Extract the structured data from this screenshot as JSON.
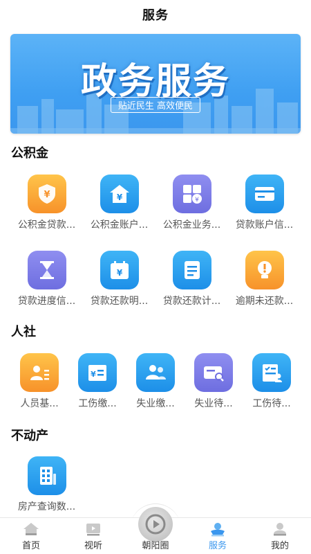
{
  "header": {
    "title": "服务"
  },
  "banner": {
    "title": "政务服务",
    "slogan": "贴近民生 高效便民"
  },
  "sections": [
    {
      "title": "公积金",
      "items": [
        {
          "label": "公积金贷款...",
          "icon": "shield-yuan-icon",
          "color": "orange"
        },
        {
          "label": "公积金账户...",
          "icon": "house-yuan-icon",
          "color": "blue"
        },
        {
          "label": "公积金业务...",
          "icon": "grid-yuan-icon",
          "color": "purple"
        },
        {
          "label": "贷款账户信...",
          "icon": "card-icon",
          "color": "blue"
        },
        {
          "label": "贷款进度信...",
          "icon": "hourglass-icon",
          "color": "purple"
        },
        {
          "label": "贷款还款明...",
          "icon": "calendar-yuan-icon",
          "color": "blue"
        },
        {
          "label": "贷款还款计...",
          "icon": "list-doc-icon",
          "color": "blue"
        },
        {
          "label": "逾期未还款...",
          "icon": "lightbulb-alert-icon",
          "color": "orange"
        }
      ]
    },
    {
      "title": "人社",
      "items": [
        {
          "label": "人员基...",
          "icon": "id-card-icon",
          "color": "orange"
        },
        {
          "label": "工伤缴...",
          "icon": "bill-yuan-icon",
          "color": "blue"
        },
        {
          "label": "失业缴...",
          "icon": "people-icon",
          "color": "blue"
        },
        {
          "label": "失业待...",
          "icon": "check-search-icon",
          "color": "purple"
        },
        {
          "label": "工伤待...",
          "icon": "form-person-icon",
          "color": "blue"
        }
      ]
    },
    {
      "title": "不动产",
      "items": [
        {
          "label": "房产查询数...",
          "icon": "building-icon",
          "color": "blue"
        }
      ]
    }
  ],
  "tabbar": {
    "items": [
      {
        "label": "首页",
        "icon": "home-icon",
        "active": false
      },
      {
        "label": "视听",
        "icon": "video-icon",
        "active": false
      },
      {
        "label": "朝阳圈",
        "icon": "circle-play-icon",
        "active": false
      },
      {
        "label": "服务",
        "icon": "service-icon",
        "active": true
      },
      {
        "label": "我的",
        "icon": "user-icon",
        "active": false
      }
    ]
  },
  "colors": {
    "accent": "#3b97ee",
    "orange": "#f7922a",
    "blue": "#1d8fe8",
    "purple": "#6e6ee0"
  }
}
